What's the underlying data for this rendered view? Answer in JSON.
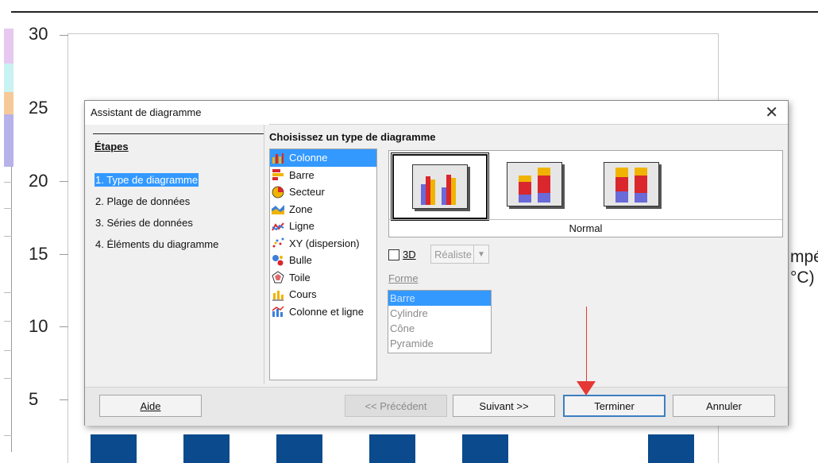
{
  "background": {
    "y_ticks": [
      "30",
      "25",
      "20",
      "15",
      "10",
      "5"
    ],
    "right_text": [
      "mpér",
      "°C)"
    ],
    "bar_color": "#0b4a8c"
  },
  "dialog": {
    "title": "Assistant de diagramme",
    "close_glyph": "✕",
    "steps_title": "Étapes",
    "steps": [
      "1. Type de diagramme",
      "2. Plage de données",
      "3. Séries de données",
      "4. Éléments du diagramme"
    ],
    "choose_label": "Choisissez un type de diagramme",
    "chart_types": [
      {
        "label": "Colonne",
        "icon": "column-chart-icon",
        "selected": true
      },
      {
        "label": "Barre",
        "icon": "bar-chart-icon"
      },
      {
        "label": "Secteur",
        "icon": "pie-chart-icon"
      },
      {
        "label": "Zone",
        "icon": "area-chart-icon"
      },
      {
        "label": "Ligne",
        "icon": "line-chart-icon"
      },
      {
        "label": "XY (dispersion)",
        "icon": "scatter-chart-icon"
      },
      {
        "label": "Bulle",
        "icon": "bubble-chart-icon"
      },
      {
        "label": "Toile",
        "icon": "net-chart-icon"
      },
      {
        "label": "Cours",
        "icon": "stock-chart-icon"
      },
      {
        "label": "Colonne et ligne",
        "icon": "column-line-chart-icon"
      }
    ],
    "variant_selected_name": "Normal",
    "checkbox_3d": "3D",
    "shape_select_value": "Réaliste",
    "forme_label": "Forme",
    "forme_items": [
      "Barre",
      "Cylindre",
      "Cône",
      "Pyramide"
    ],
    "buttons": {
      "help": "Aide",
      "previous": "<< Précédent",
      "next": "Suivant >>",
      "finish": "Terminer",
      "cancel": "Annuler"
    },
    "accent": "#3399ff"
  }
}
